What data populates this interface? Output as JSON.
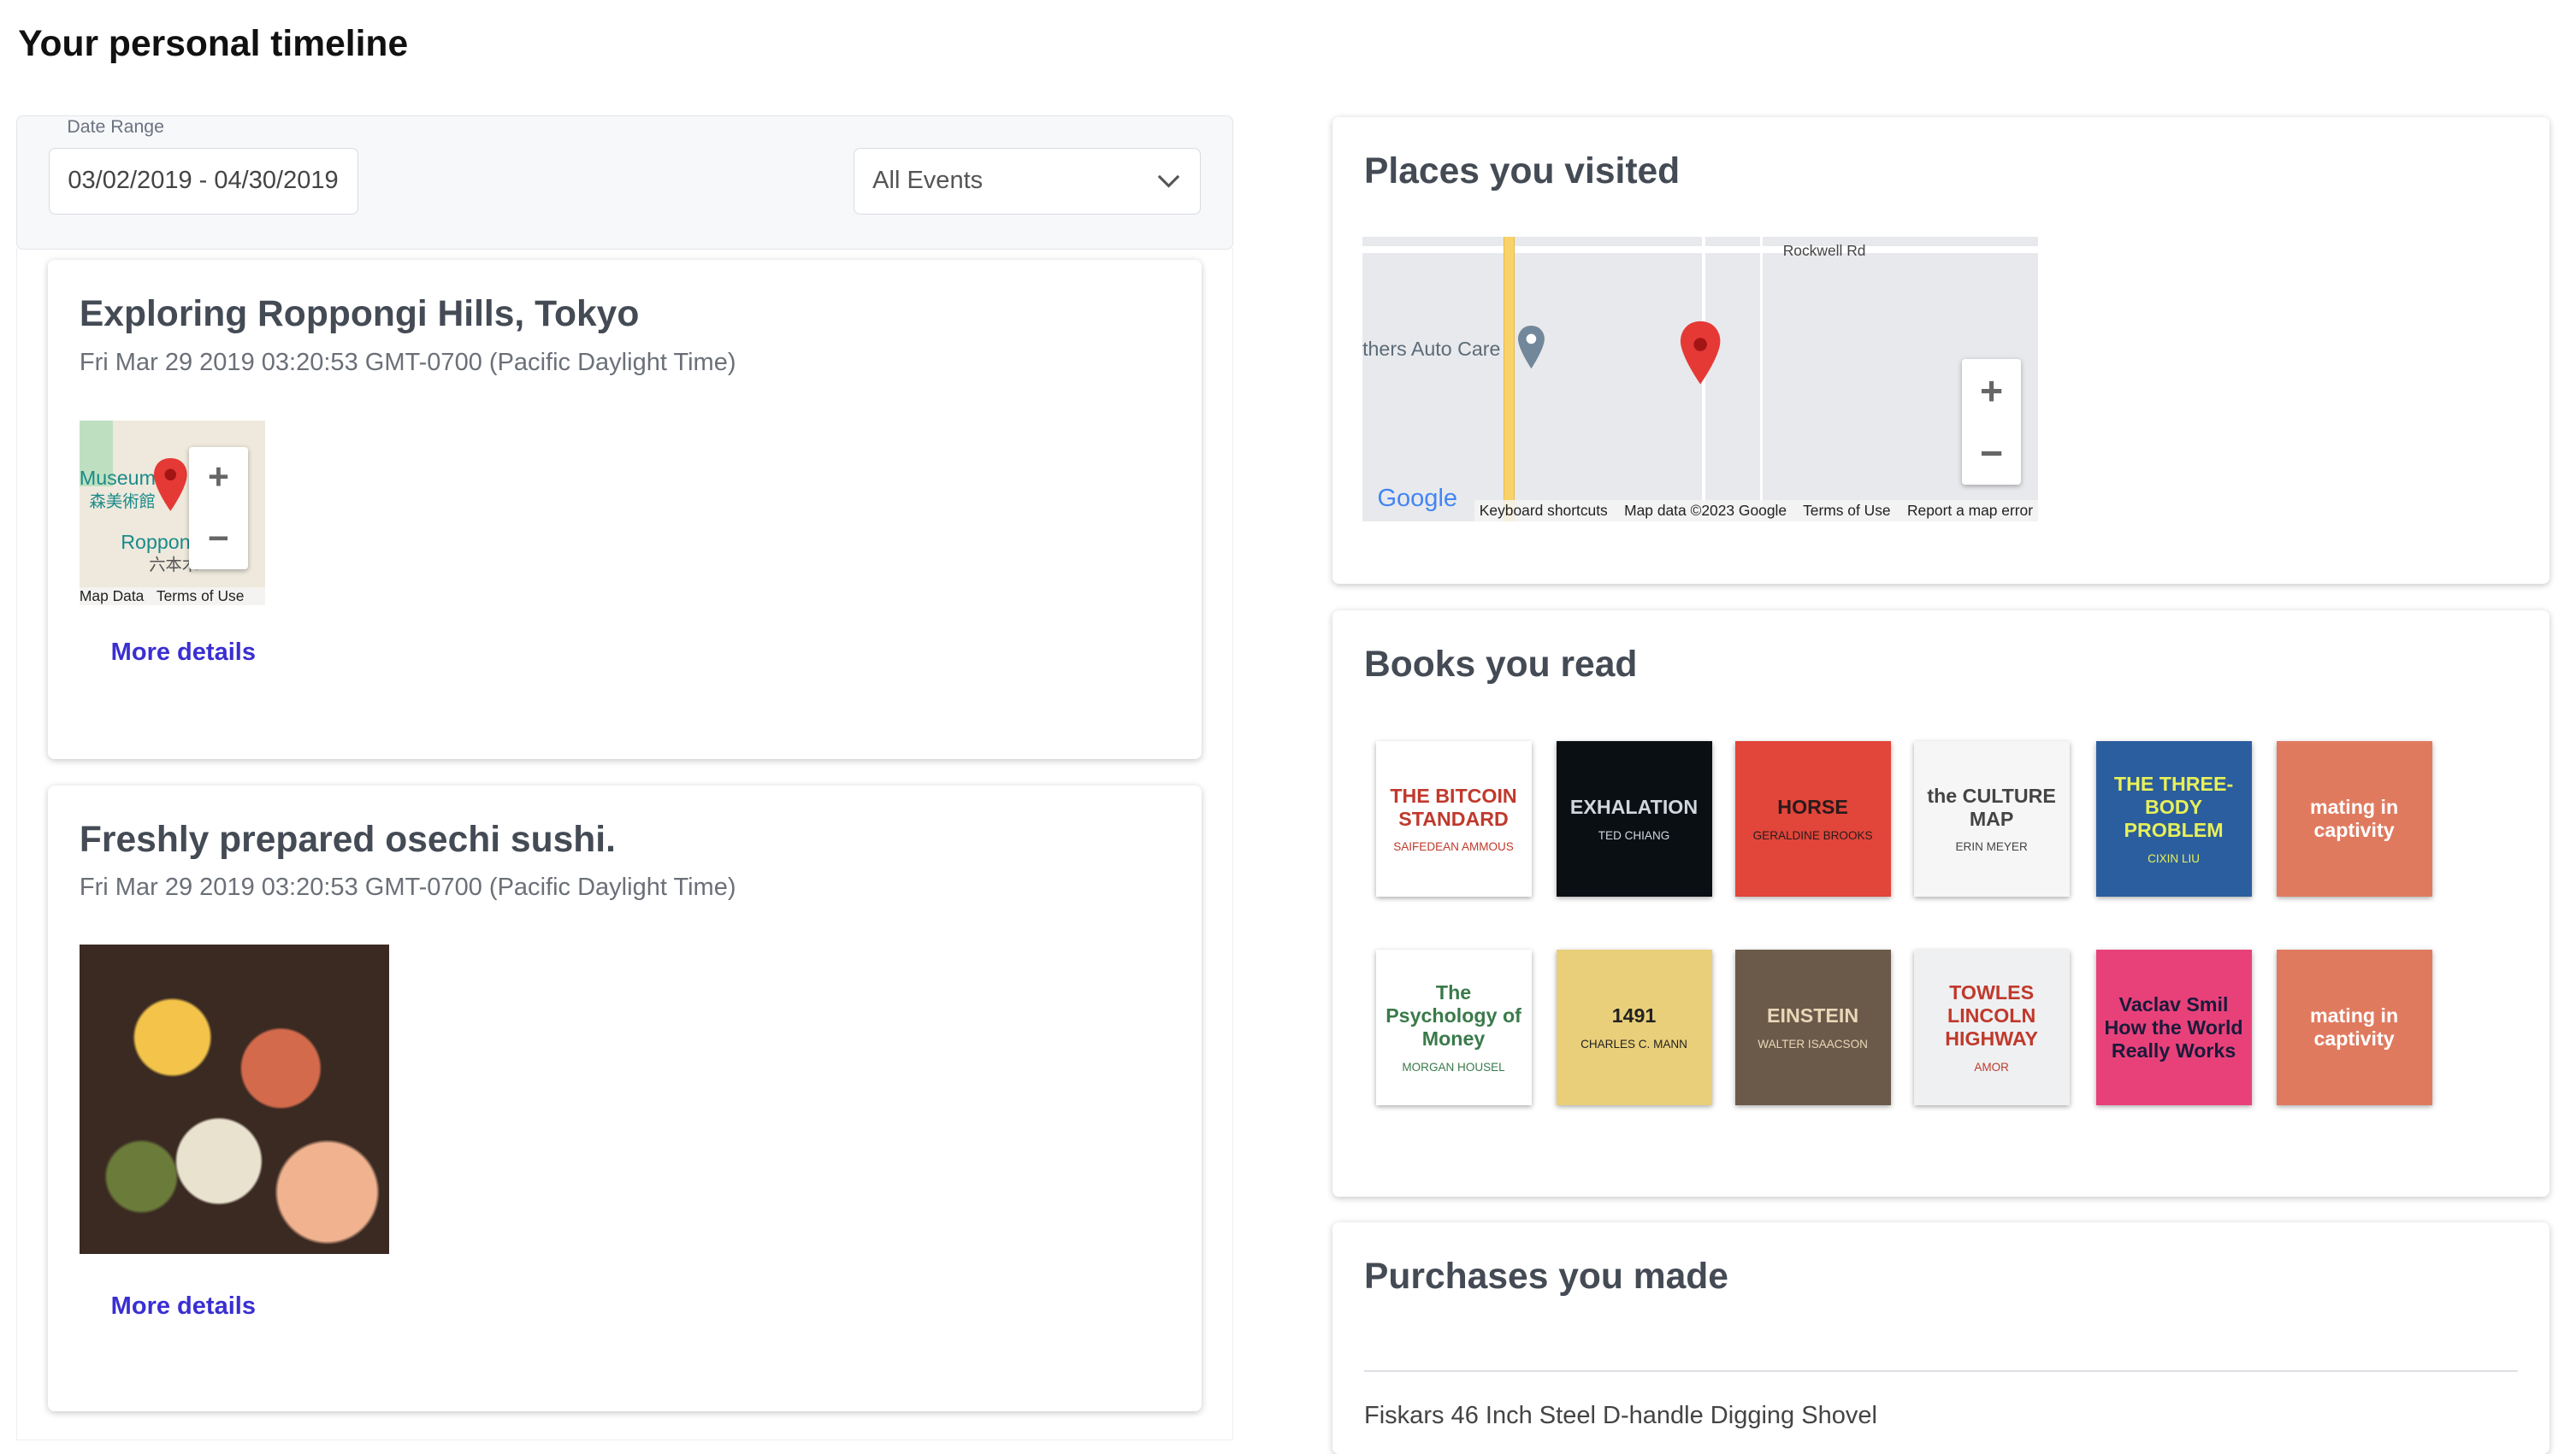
{
  "page": {
    "title": "Your personal timeline"
  },
  "filters": {
    "date_label": "Date Range",
    "date_value": "03/02/2019 - 04/30/2019",
    "event_type": "All Events"
  },
  "events": [
    {
      "title": "Exploring Roppongi Hills, Tokyo",
      "date": "Fri Mar 29 2019 03:20:53 GMT-0700 (Pacific Daylight Time)",
      "map": {
        "label1": "Museum",
        "label1_jp": "森美術館",
        "label2": "Roppon",
        "label2_jp": "六本木",
        "attr_data": "Map Data",
        "attr_terms": "Terms of Use"
      },
      "more": "More details"
    },
    {
      "title": "Freshly prepared osechi sushi.",
      "date": "Fri Mar 29 2019 03:20:53 GMT-0700 (Pacific Daylight Time)",
      "more": "More details"
    }
  ],
  "places": {
    "title": "Places you visited",
    "map": {
      "road": "Rockwell Rd",
      "poi": "thers Auto Care",
      "logo": "Google",
      "links": [
        "Keyboard shortcuts",
        "Map data ©2023 Google",
        "Terms of Use",
        "Report a map error"
      ]
    }
  },
  "books": {
    "title": "Books you read",
    "items": [
      {
        "title": "THE BITCOIN STANDARD",
        "author": "SAIFEDEAN AMMOUS",
        "bg": "#ffffff",
        "fg": "#c0392b"
      },
      {
        "title": "EXHALATION",
        "author": "TED CHIANG",
        "bg": "#0a0f14",
        "fg": "#cfd8dc"
      },
      {
        "title": "HORSE",
        "author": "GERALDINE BROOKS",
        "bg": "#e2453a",
        "fg": "#2a1a1a"
      },
      {
        "title": "the CULTURE MAP",
        "author": "ERIN MEYER",
        "bg": "#f6f6f6",
        "fg": "#444"
      },
      {
        "title": "THE THREE-BODY PROBLEM",
        "author": "CIXIN LIU",
        "bg": "#2b5e9e",
        "fg": "#e8f05a"
      },
      {
        "title": "mating in captivity",
        "author": "",
        "bg": "#e07a5f",
        "fg": "#fff"
      },
      {
        "title": "The Psychology of Money",
        "author": "MORGAN HOUSEL",
        "bg": "#ffffff",
        "fg": "#3a7a4a"
      },
      {
        "title": "1491",
        "author": "CHARLES C. MANN",
        "bg": "#e9cf7a",
        "fg": "#222"
      },
      {
        "title": "EINSTEIN",
        "author": "WALTER ISAACSON",
        "bg": "#6b5a4a",
        "fg": "#e8d8b8"
      },
      {
        "title": "TOWLES LINCOLN HIGHWAY",
        "author": "AMOR",
        "bg": "#eef0f2",
        "fg": "#c0392b"
      },
      {
        "title": "Vaclav Smil How the World Really Works",
        "author": "",
        "bg": "#e8417a",
        "fg": "#1a1a3a"
      },
      {
        "title": "mating in captivity",
        "author": "",
        "bg": "#e07a5f",
        "fg": "#fff"
      }
    ]
  },
  "purchases": {
    "title": "Purchases you made",
    "items": [
      "Fiskars 46 Inch Steel D-handle Digging Shovel"
    ]
  },
  "colors": {
    "link": "#3a2fd1",
    "pin": "#e53935",
    "road_highlight": "#f9d36a"
  }
}
